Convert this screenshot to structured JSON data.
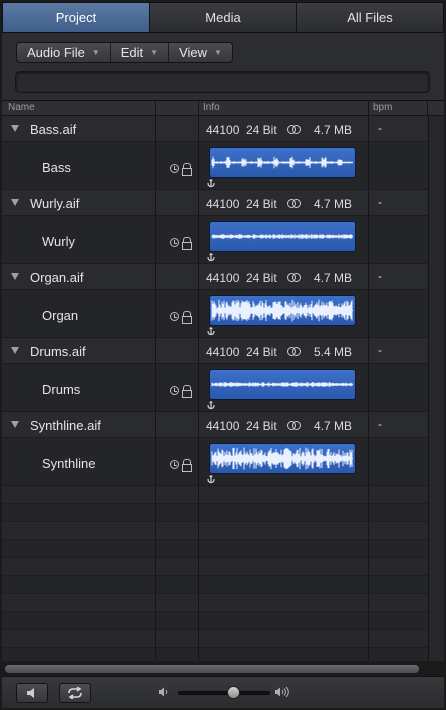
{
  "tabs": [
    {
      "label": "Project",
      "active": true
    },
    {
      "label": "Media",
      "active": false
    },
    {
      "label": "All Files",
      "active": false
    }
  ],
  "toolbar": {
    "menus": [
      {
        "label": "Audio File",
        "icon": "chevron-down-icon"
      },
      {
        "label": "Edit",
        "icon": "chevron-down-icon"
      },
      {
        "label": "View",
        "icon": "chevron-down-icon"
      }
    ],
    "search": {
      "value": "",
      "placeholder": ""
    }
  },
  "columns": {
    "name": "Name",
    "info": "Info",
    "bpm": "bpm"
  },
  "files": [
    {
      "file": "Bass.aif",
      "sample_rate": "44100",
      "bit_depth": "24 Bit",
      "size": "4.7 MB",
      "bpm": "-",
      "region": "Bass",
      "wave": "sparse"
    },
    {
      "file": "Wurly.aif",
      "sample_rate": "44100",
      "bit_depth": "24 Bit",
      "size": "4.7 MB",
      "bpm": "-",
      "region": "Wurly",
      "wave": "thin"
    },
    {
      "file": "Organ.aif",
      "sample_rate": "44100",
      "bit_depth": "24 Bit",
      "size": "4.7 MB",
      "bpm": "-",
      "region": "Organ",
      "wave": "dense"
    },
    {
      "file": "Drums.aif",
      "sample_rate": "44100",
      "bit_depth": "24 Bit",
      "size": "5.4 MB",
      "bpm": "-",
      "region": "Drums",
      "wave": "thin"
    },
    {
      "file": "Synthline.aif",
      "sample_rate": "44100",
      "bit_depth": "24 Bit",
      "size": "4.7 MB",
      "bpm": "-",
      "region": "Synthline",
      "wave": "dense"
    }
  ],
  "bottom_bar": {
    "buttons": [
      {
        "icon": "speaker-icon"
      },
      {
        "icon": "loop-icon"
      }
    ],
    "volume": {
      "level": 0.6,
      "low_icon": "volume-low-icon",
      "high_icon": "volume-high-icon"
    }
  },
  "colors": {
    "region": "#3465bb",
    "active_tab": "#4d6d98"
  }
}
